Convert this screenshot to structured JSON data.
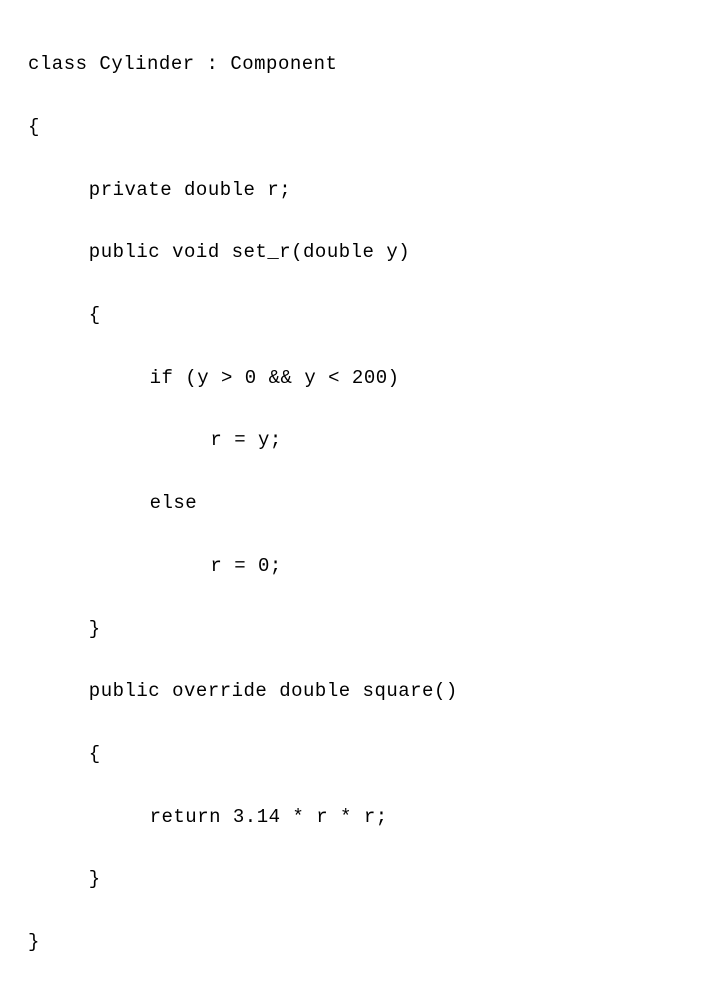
{
  "code": {
    "line1": "class Cylinder : Component",
    "line2": "{",
    "line3": "private double r;",
    "line4": "public void set_r(double y)",
    "line5": "{",
    "line6": "if (y > 0 && y < 200)",
    "line7": "r = y;",
    "line8": "else",
    "line9": "r = 0;",
    "line10": "}",
    "line11": "public override double square()",
    "line12": "{",
    "line13": "return 3.14 * r * r;",
    "line14": "}",
    "line15": "}"
  }
}
